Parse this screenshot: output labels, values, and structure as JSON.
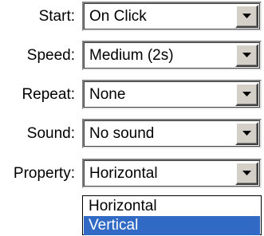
{
  "form": {
    "fields": [
      {
        "label": "Start:",
        "value": "On Click"
      },
      {
        "label": "Speed:",
        "value": "Medium (2s)"
      },
      {
        "label": "Repeat:",
        "value": "None"
      },
      {
        "label": "Sound:",
        "value": "No sound"
      },
      {
        "label": "Property:",
        "value": "Horizontal"
      }
    ]
  },
  "dropdown": {
    "options": [
      "Horizontal",
      "Vertical"
    ],
    "highlighted": "Vertical"
  },
  "colors": {
    "highlight": "#316ac5",
    "button_face": "#d4d0c8"
  },
  "icons": {
    "dropdown_arrow": "chevron-down-icon"
  }
}
